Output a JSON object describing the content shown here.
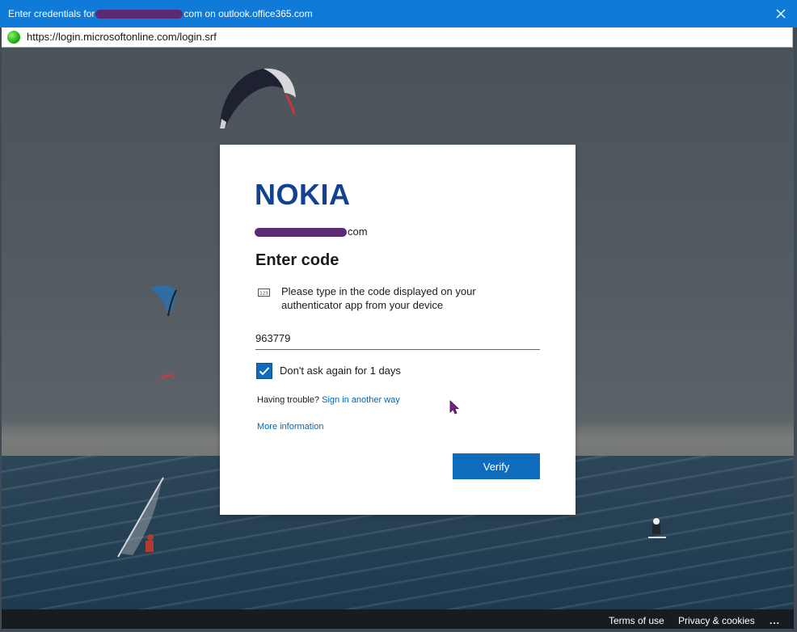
{
  "window": {
    "title_prefix": "Enter credentials for",
    "title_suffix": "com on outlook.office365.com",
    "close_icon": "close-icon"
  },
  "address_bar": {
    "url": "https://login.microsoftonline.com/login.srf",
    "security_icon": "secure-connection-icon"
  },
  "dialog": {
    "logo_text": "NOKIA",
    "account_suffix": "com",
    "heading": "Enter code",
    "instructions": "Please type in the code displayed on your authenticator app from your device",
    "code_value": "963779",
    "remember_checked": true,
    "remember_label": "Don't ask again for 1 days",
    "trouble_text": "Having trouble?",
    "sign_in_other_label": "Sign in another way",
    "more_info_label": "More information",
    "verify_label": "Verify",
    "accent_color": "#0f6cbd",
    "logo_color": "#124191"
  },
  "footer": {
    "terms_label": "Terms of use",
    "privacy_label": "Privacy & cookies",
    "more_label": "..."
  }
}
